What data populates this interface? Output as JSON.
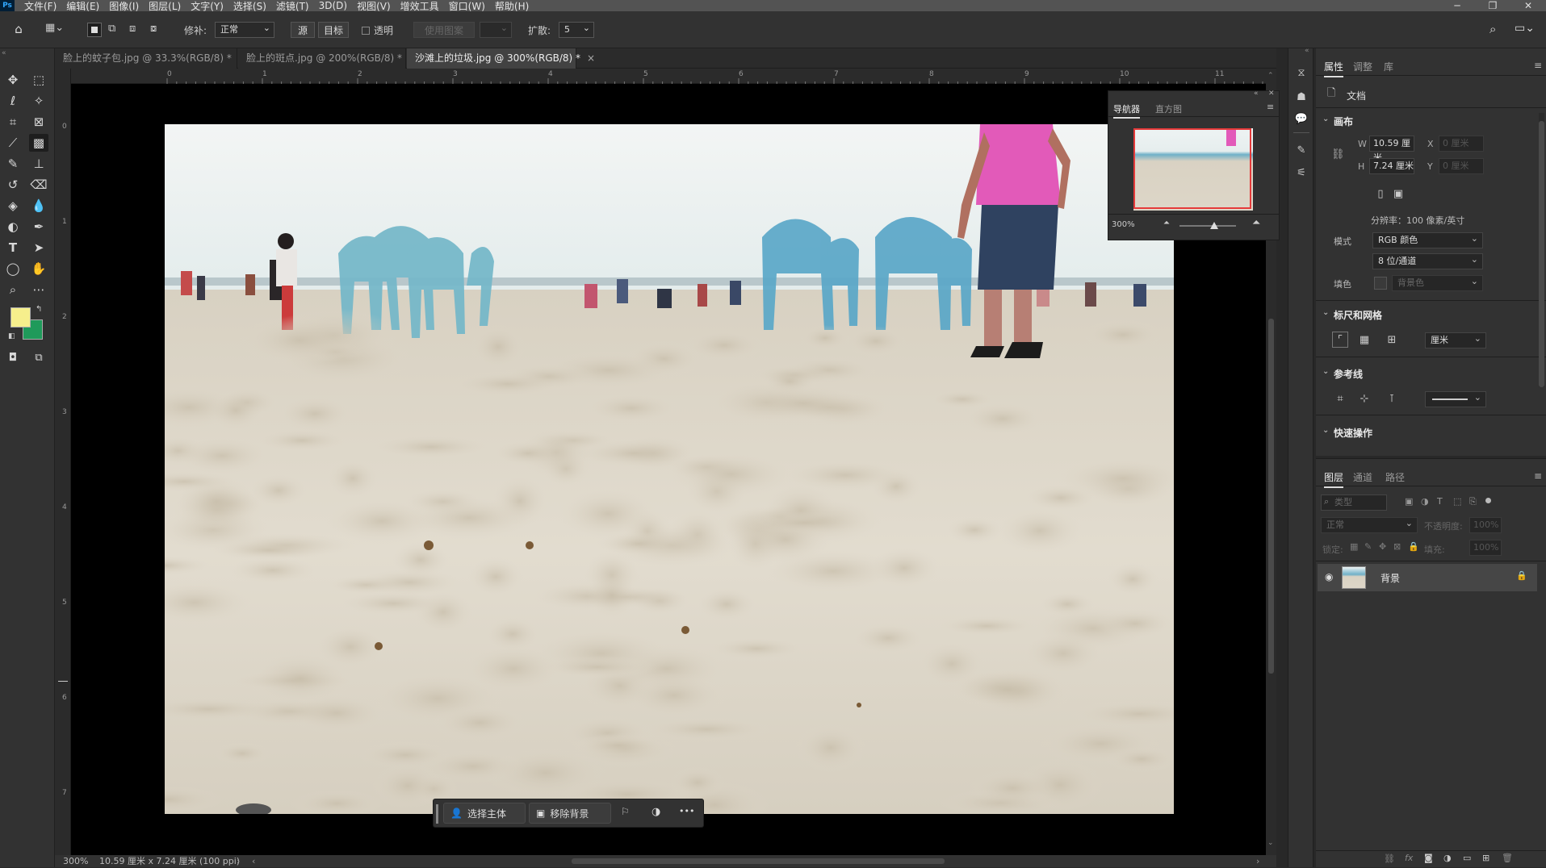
{
  "app": {
    "logo": "Ps"
  },
  "menu": [
    "文件(F)",
    "编辑(E)",
    "图像(I)",
    "图层(L)",
    "文字(Y)",
    "选择(S)",
    "滤镜(T)",
    "3D(D)",
    "视图(V)",
    "增效工具",
    "窗口(W)",
    "帮助(H)"
  ],
  "window_controls": {
    "minimize": "─",
    "restore": "❐",
    "close": "✕"
  },
  "options": {
    "repair_label": "修补:",
    "repair_mode": "正常",
    "source_btn": "源",
    "target_btn": "目标",
    "transparent_label": "透明",
    "use_pattern_btn": "使用图案",
    "diffuse_label": "扩散:",
    "diffuse_value": "5"
  },
  "tabs": [
    {
      "label": "脸上的蚊子包.jpg @ 33.3%(RGB/8) *",
      "close": "×"
    },
    {
      "label": "脸上的斑点.jpg @ 200%(RGB/8) *",
      "close": "×"
    },
    {
      "label": "沙滩上的垃圾.jpg @ 300%(RGB/8) *",
      "close": "×"
    }
  ],
  "ruler_top": [
    "0",
    "1",
    "2",
    "3",
    "4",
    "5",
    "6",
    "7",
    "8",
    "9",
    "10",
    "11"
  ],
  "ruler_left": [
    "0",
    "1",
    "2",
    "3",
    "4",
    "5",
    "6",
    "7"
  ],
  "context_bar": {
    "select_subject": "选择主体",
    "remove_bg": "移除背景",
    "more": "•••"
  },
  "status": {
    "zoom": "300%",
    "doc_info": "10.59 厘米 x 7.24 厘米 (100 ppi)"
  },
  "navigator": {
    "tab_navigator": "导航器",
    "tab_histogram": "直方图",
    "zoom": "300%",
    "zoom_fraction": 0.62
  },
  "properties": {
    "tabs": [
      "属性",
      "调整",
      "库"
    ],
    "doc_label": "文档",
    "canvas_section": "画布",
    "w_label": "W",
    "w_value": "10.59 厘米",
    "h_label": "H",
    "h_value": "7.24 厘米",
    "x_label": "X",
    "x_placeholder": "0 厘米",
    "y_label": "Y",
    "y_placeholder": "0 厘米",
    "resolution": "分辨率：100 像素/英寸",
    "mode_label": "模式",
    "mode_value": "RGB 颜色",
    "bits_value": "8 位/通道",
    "fill_label": "填色",
    "fill_value": "背景色",
    "rulers_section": "标尺和网格",
    "unit_value": "厘米",
    "guides_section": "参考线",
    "quick_actions_section": "快速操作"
  },
  "layers": {
    "tabs": [
      "图层",
      "通道",
      "路径"
    ],
    "filter_placeholder": "类型",
    "blend_mode": "正常",
    "opacity_label": "不透明度:",
    "opacity_value": "100%",
    "lock_label": "锁定:",
    "fill_label": "填充:",
    "fill_value": "100%",
    "layer_name": "背景"
  },
  "colors": {
    "foreground": "#f6ef8c",
    "background": "#1f9a5a",
    "accent": "#e8e8e8"
  }
}
